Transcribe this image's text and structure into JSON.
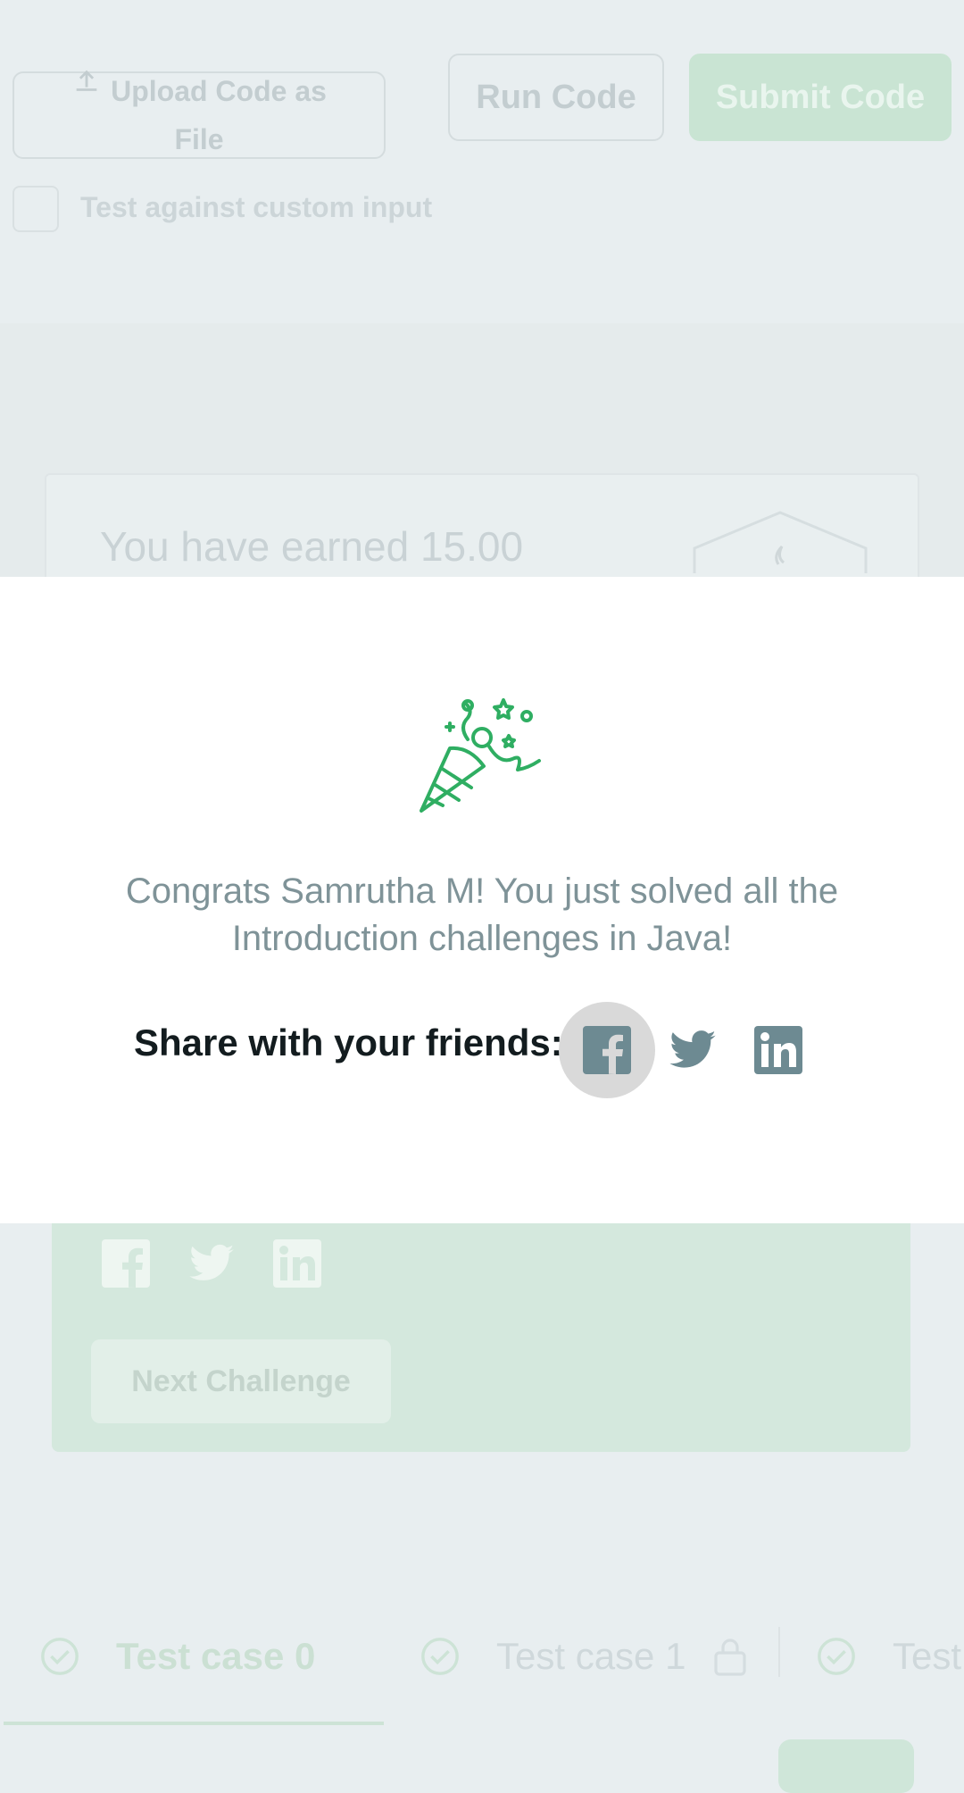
{
  "background": {
    "upload_button": {
      "line1": "Upload Code as",
      "line2": "File"
    },
    "run_button": "Run Code",
    "submit_button": "Submit Code",
    "custom_input_label": "Test against custom input",
    "earned_text": "You have earned 15.00",
    "next_challenge_button": "Next Challenge",
    "tabs": [
      {
        "label": "Test case 0"
      },
      {
        "label": "Test case 1"
      },
      {
        "label": "Test"
      }
    ]
  },
  "modal": {
    "icon": "party-popper-icon",
    "message": "Congrats Samrutha M! You just solved all the Introduction challenges in Java!",
    "share_label": "Share with your friends:",
    "social": [
      {
        "name": "facebook-icon"
      },
      {
        "name": "twitter-icon"
      },
      {
        "name": "linkedin-icon"
      }
    ]
  },
  "colors": {
    "accent": "#2ec866",
    "social_icon": "#6d8a92",
    "overlay": "#e8eef0"
  }
}
